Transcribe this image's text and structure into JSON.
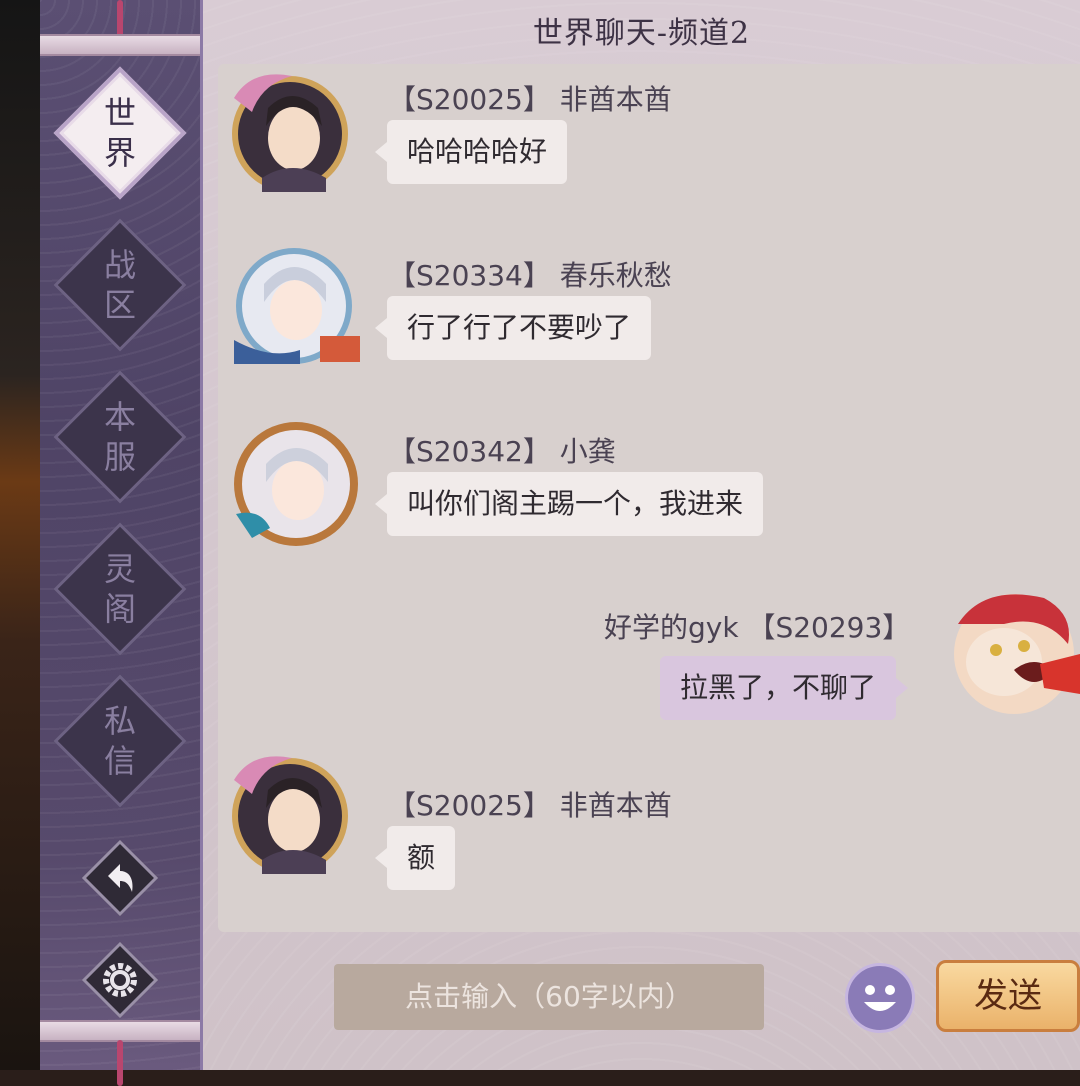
{
  "channel_title": "世界聊天-频道2",
  "tabs": [
    {
      "label_top": "世",
      "label_bottom": "界",
      "active": true
    },
    {
      "label_top": "战",
      "label_bottom": "区",
      "active": false
    },
    {
      "label_top": "本",
      "label_bottom": "服",
      "active": false
    },
    {
      "label_top": "灵",
      "label_bottom": "阁",
      "active": false
    },
    {
      "label_top": "私",
      "label_bottom": "信",
      "active": false
    }
  ],
  "messages": [
    {
      "meta": "【S20025】 非酋本酋",
      "text": "哈哈哈哈好",
      "side": "left"
    },
    {
      "meta": "【S20334】 春乐秋愁",
      "text": "行了行了不要吵了",
      "side": "left"
    },
    {
      "meta": "【S20342】 小龚",
      "text": "叫你们阁主踢一个，我进来",
      "side": "left"
    },
    {
      "meta": "好学的gyk 【S20293】",
      "text": "拉黑了，不聊了",
      "side": "right"
    },
    {
      "meta": "【S20025】 非酋本酋",
      "text": "额",
      "side": "left"
    }
  ],
  "input": {
    "placeholder": "点击输入（60字以内）"
  },
  "send_label": "发送",
  "icons": {
    "back": "back-arrow-icon",
    "settings": "gear-icon",
    "emoji": "smiley-icon"
  },
  "colors": {
    "sidebar": "#574a6c",
    "chat_bg": "#d8d0ce",
    "send_button": "#eab26a",
    "own_bubble": "#d9c6de"
  }
}
